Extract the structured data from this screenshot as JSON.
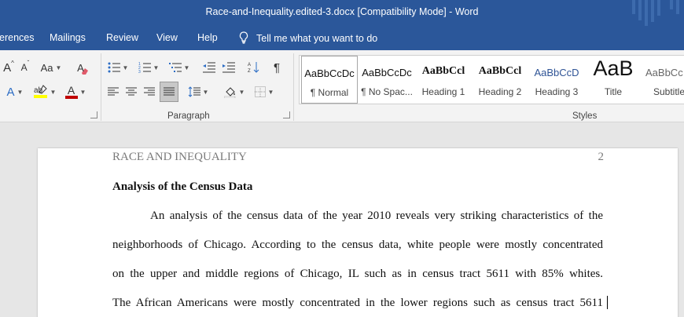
{
  "window": {
    "title": "Race-and-Inequality.edited-3.docx [Compatibility Mode]  -  Word"
  },
  "tabs": [
    "erences",
    "Mailings",
    "Review",
    "View",
    "Help"
  ],
  "tell_me": "Tell me what you want to do",
  "ribbon": {
    "font_row1": {
      "grow": "A",
      "shrink": "A",
      "case": "Aa",
      "clear": "A"
    },
    "font_row2": {
      "effects": "A",
      "color": "A"
    },
    "paragraph_label": "Paragraph",
    "styles_label": "Styles",
    "styles": [
      {
        "preview": "AaBbCcDc",
        "label": "¶ Normal"
      },
      {
        "preview": "AaBbCcDc",
        "label": "¶ No Spac..."
      },
      {
        "preview": "AaBbCcl",
        "label": "Heading 1"
      },
      {
        "preview": "AaBbCcl",
        "label": "Heading 2"
      },
      {
        "preview": "AaBbCcD",
        "label": "Heading 3"
      },
      {
        "preview": "AaB",
        "label": "Title"
      },
      {
        "preview": "AaBbCc",
        "label": "Subtitle"
      }
    ]
  },
  "colors": {
    "title_bar": "#2b579a",
    "highlight": "#ffff00",
    "font_color": "#c00000",
    "heading3_preview": "#2f5496"
  },
  "document": {
    "running_head": "RACE AND INEQUALITY",
    "page_number": "2",
    "heading": "Analysis of the Census Data",
    "lines": [
      "An analysis of the census data of the year 2010 reveals very striking characteristics of the",
      "neighborhoods of Chicago. According to the census data, white people were mostly concentrated",
      "on the upper and middle regions of Chicago, IL such as in census tract 5611 with 85% whites.",
      "The African Americans were mostly concentrated in the lower regions such as census tract 5611"
    ]
  }
}
